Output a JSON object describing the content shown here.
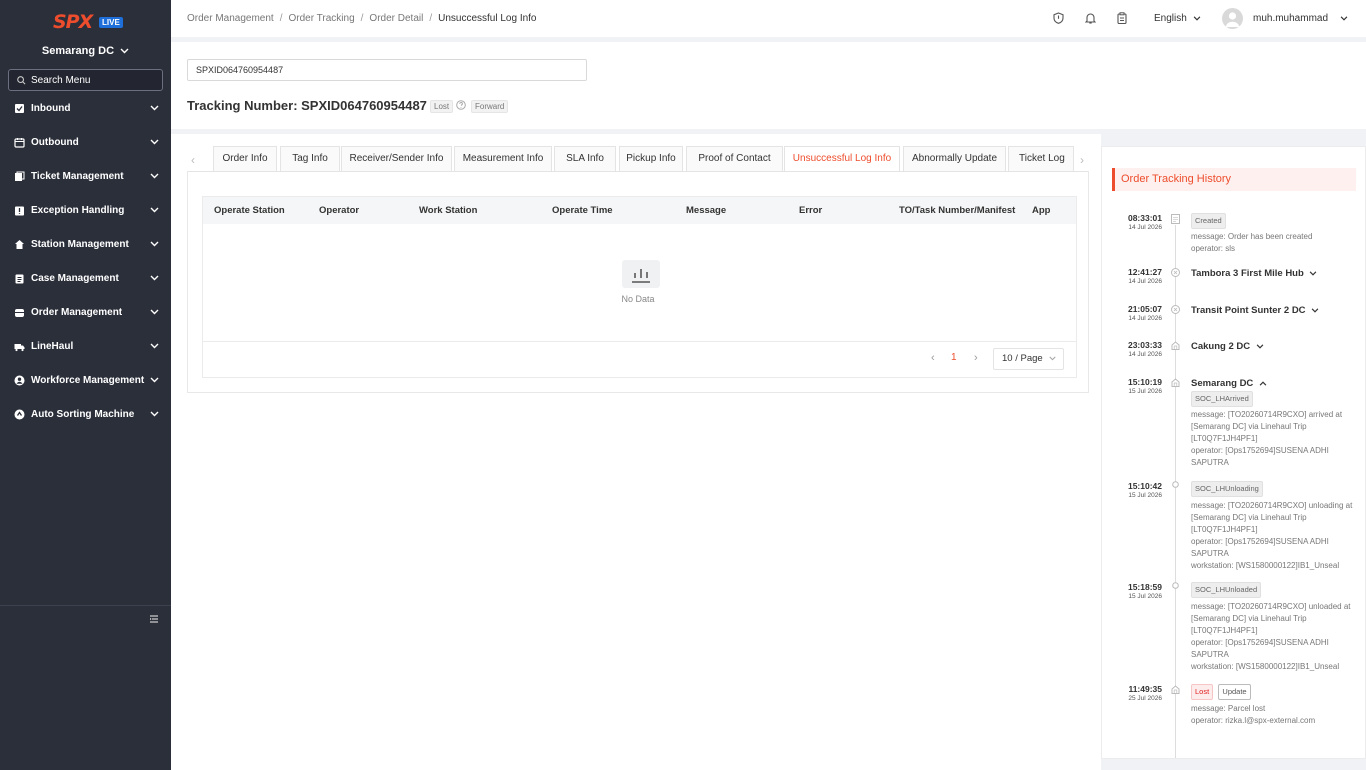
{
  "sidebar": {
    "logo_text": "SPX",
    "logo_badge": "LIVE",
    "station": "Semarang DC",
    "search_placeholder": "Search Menu",
    "items": [
      {
        "label": "Inbound",
        "icon": "inbound-icon"
      },
      {
        "label": "Outbound",
        "icon": "outbound-icon"
      },
      {
        "label": "Ticket Management",
        "icon": "ticket-icon"
      },
      {
        "label": "Exception Handling",
        "icon": "exception-icon"
      },
      {
        "label": "Station Management",
        "icon": "home-icon"
      },
      {
        "label": "Case Management",
        "icon": "case-icon"
      },
      {
        "label": "Order Management",
        "icon": "order-icon"
      },
      {
        "label": "LineHaul",
        "icon": "truck-icon"
      },
      {
        "label": "Workforce Management",
        "icon": "user-icon"
      },
      {
        "label": "Auto Sorting Machine",
        "icon": "sorting-icon"
      }
    ]
  },
  "header": {
    "breadcrumb": [
      "Order Management",
      "Order Tracking",
      "Order Detail",
      "Unsuccessful Log Info"
    ],
    "language": "English",
    "username": "muh.muhammad"
  },
  "search": {
    "tracking_input": "SPXID064760954487",
    "title_prefix": "Tracking Number: ",
    "tracking_number": "SPXID064760954487",
    "status_badge": "Lost",
    "direction_badge": "Forward"
  },
  "tabs": [
    "Order Info",
    "Tag Info",
    "Receiver/Sender Info",
    "Measurement Info",
    "SLA Info",
    "Pickup Info",
    "Proof of Contact",
    "Unsuccessful Log Info",
    "Abnormally Update",
    "Ticket Log"
  ],
  "active_tab": "Unsuccessful Log Info",
  "table": {
    "columns": [
      "Operate Station",
      "Operator",
      "Work Station",
      "Operate Time",
      "Message",
      "Error",
      "TO/Task Number/Manifest",
      "App"
    ],
    "empty_text": "No Data",
    "page": "1",
    "page_size": "10 / Page"
  },
  "history": {
    "title": "Order Tracking History",
    "events": [
      {
        "time": "08:33:01",
        "date": "14 Jul 2026",
        "tag": "Created",
        "lines": [
          "message: Order has been created",
          "operator: sls"
        ]
      },
      {
        "time": "12:41:27",
        "date": "14 Jul 2026",
        "location": "Tambora 3 First Mile Hub"
      },
      {
        "time": "21:05:07",
        "date": "14 Jul 2026",
        "location": "Transit Point Sunter 2 DC"
      },
      {
        "time": "23:03:33",
        "date": "14 Jul 2026",
        "location": "Cakung 2 DC"
      },
      {
        "time": "15:10:19",
        "date": "15 Jul 2026",
        "location": "Semarang DC",
        "tag": "SOC_LHArrived",
        "lines": [
          "message: [TO20260714R9CXO] arrived at",
          "[Semarang DC] via Linehaul Trip",
          "[LT0Q7F1JH4PF1]",
          "operator: [Ops1752694]SUSENA ADHI",
          "SAPUTRA"
        ]
      },
      {
        "time": "15:10:42",
        "date": "15 Jul 2026",
        "tag": "SOC_LHUnloading",
        "lines": [
          "message: [TO20260714R9CXO] unloading at",
          "[Semarang DC] via Linehaul Trip",
          "[LT0Q7F1JH4PF1]",
          "operator: [Ops1752694]SUSENA ADHI",
          "SAPUTRA",
          "workstation: [WS1580000122]IB1_Unseal"
        ]
      },
      {
        "time": "15:18:59",
        "date": "15 Jul 2026",
        "tag": "SOC_LHUnloaded",
        "lines": [
          "message: [TO20260714R9CXO] unloaded at",
          "[Semarang DC] via Linehaul Trip",
          "[LT0Q7F1JH4PF1]",
          "operator: [Ops1752694]SUSENA ADHI",
          "SAPUTRA",
          "workstation: [WS1580000122]IB1_Unseal"
        ]
      },
      {
        "time": "11:49:35",
        "date": "25 Jul 2026",
        "tag": "Lost",
        "tag2": "Update",
        "lines": [
          "message: Parcel lost",
          "operator: rizka.l@spx-external.com"
        ]
      }
    ]
  },
  "colors": {
    "accent": "#ee4d2d",
    "sidebar_bg": "#2b2f3a",
    "live_badge": "#1e6fd9"
  }
}
